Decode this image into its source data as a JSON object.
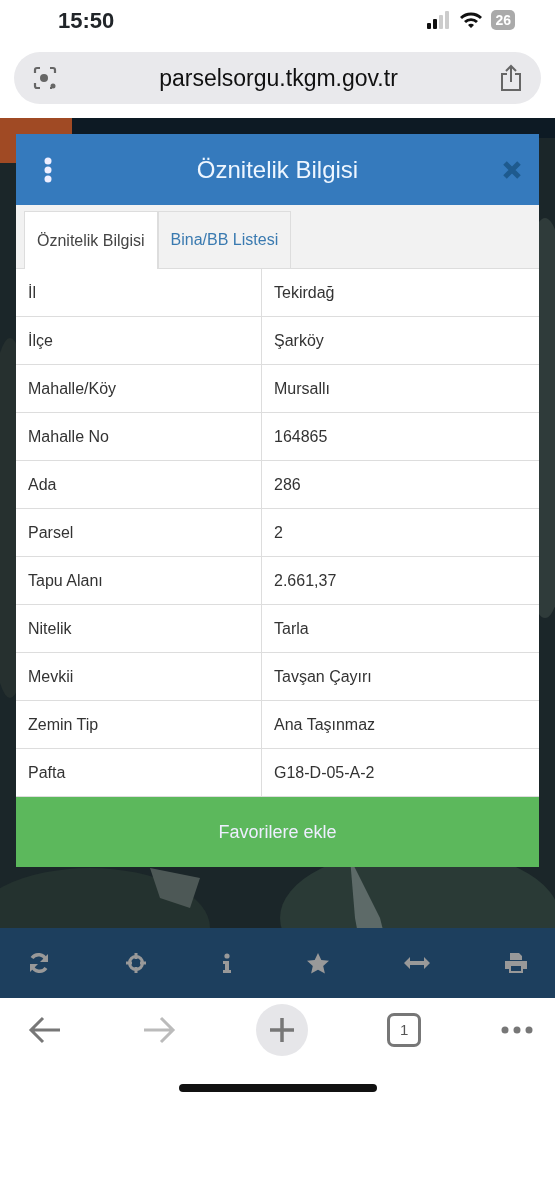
{
  "status_bar": {
    "time": "15:50",
    "battery": "26"
  },
  "address_bar": {
    "url": "parselsorgu.tkgm.gov.tr"
  },
  "dialog": {
    "title": "Öznitelik Bilgisi",
    "tabs": [
      {
        "label": "Öznitelik Bilgisi",
        "selected": true
      },
      {
        "label": "Bina/BB Listesi",
        "selected": false
      }
    ],
    "rows": [
      {
        "label": "İl",
        "value": "Tekirdağ"
      },
      {
        "label": "İlçe",
        "value": "Şarköy"
      },
      {
        "label": "Mahalle/Köy",
        "value": "Mursallı"
      },
      {
        "label": "Mahalle No",
        "value": "164865"
      },
      {
        "label": "Ada",
        "value": "286"
      },
      {
        "label": "Parsel",
        "value": "2"
      },
      {
        "label": "Tapu Alanı",
        "value": "2.661,37"
      },
      {
        "label": "Nitelik",
        "value": "Tarla"
      },
      {
        "label": "Mevkii",
        "value": "Tavşan Çayırı"
      },
      {
        "label": "Zemin Tip",
        "value": "Ana Taşınmaz"
      },
      {
        "label": "Pafta",
        "value": "G18-D-05-A-2"
      }
    ],
    "button": "Favorilere ekle"
  },
  "browser_bar": {
    "tab_count": "1"
  }
}
